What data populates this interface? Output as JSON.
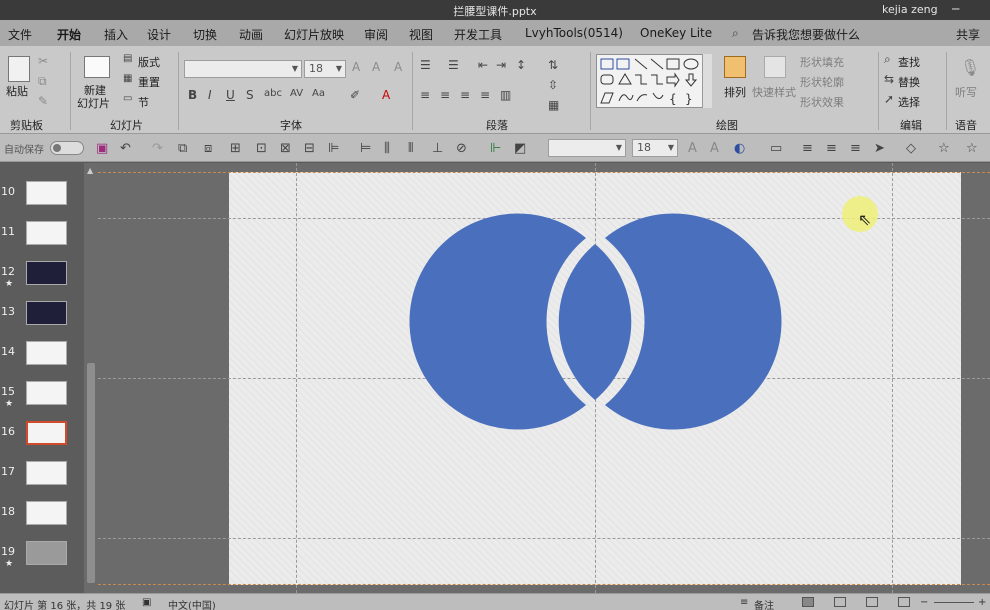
{
  "window": {
    "title": "拦腰型课件.pptx",
    "user": "kejia zeng"
  },
  "tabs": [
    "文件",
    "开始",
    "插入",
    "设计",
    "切换",
    "动画",
    "幻灯片放映",
    "审阅",
    "视图",
    "开发工具",
    "LvyhTools(0514)",
    "OneKey Lite"
  ],
  "search_placeholder": "告诉我您想要做什么",
  "share_label": "共享",
  "ribbon": {
    "clipboard": {
      "paste": "粘贴",
      "label": "剪贴板"
    },
    "slides": {
      "new_slide": "新建",
      "new_slide2": "幻灯片",
      "layout": "版式",
      "reset": "重置",
      "section": "节",
      "label": "幻灯片"
    },
    "font": {
      "size": "18",
      "label": "字体"
    },
    "paragraph": {
      "label": "段落"
    },
    "drawing": {
      "arrange": "排列",
      "quick_styles": "快速样式",
      "shape_fill": "形状填充",
      "shape_outline": "形状轮廓",
      "shape_effects": "形状效果",
      "label": "绘图"
    },
    "editing": {
      "find": "查找",
      "replace": "替换",
      "select": "选择",
      "label": "编辑"
    },
    "voice": {
      "dictate": "听写",
      "label": "语音"
    }
  },
  "qab": {
    "autosave": "自动保存",
    "font_size": "18"
  },
  "slides": [
    {
      "num": "10",
      "star": false,
      "style": "light"
    },
    {
      "num": "11",
      "star": false,
      "style": "light"
    },
    {
      "num": "12",
      "star": true,
      "style": "dark"
    },
    {
      "num": "13",
      "star": false,
      "style": "dark"
    },
    {
      "num": "14",
      "star": false,
      "style": "light"
    },
    {
      "num": "15",
      "star": true,
      "style": "light"
    },
    {
      "num": "16",
      "star": false,
      "style": "active"
    },
    {
      "num": "17",
      "star": false,
      "style": "light"
    },
    {
      "num": "18",
      "star": false,
      "style": "light"
    },
    {
      "num": "19",
      "star": true,
      "style": "grey"
    }
  ],
  "status": {
    "slide_info": "幻灯片 第 16 张，共 19 张",
    "language": "中文(中国)",
    "notes": "备注"
  },
  "colors": {
    "venn_fill": "#4a6fbd",
    "accent": "#b7472a"
  }
}
